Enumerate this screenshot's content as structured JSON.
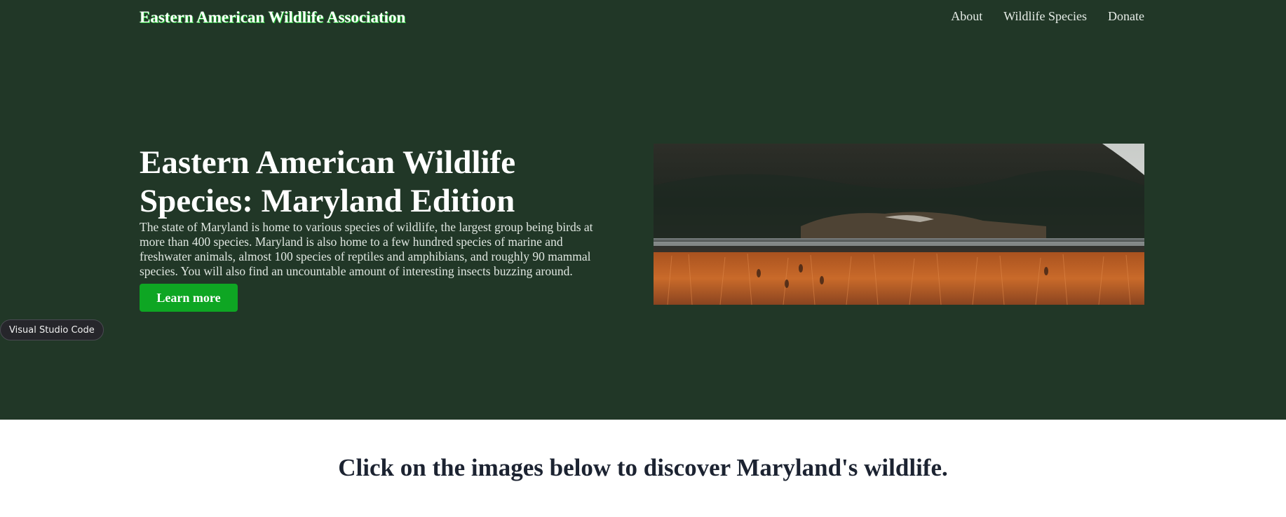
{
  "header": {
    "brand": "Eastern American Wildlife Association",
    "nav": [
      "About",
      "Wildlife Species",
      "Donate"
    ]
  },
  "hero": {
    "title": "Eastern American Wildlife Species: Maryland Edition",
    "description": "The state of Maryland is home to various species of wildlife, the largest group being birds at more than 400 species. Maryland is also home to a few hundred species of marine and freshwater animals, almost 100 species of reptiles and amphibians, and roughly 90 mammal species. You will also find an uncountable amount of interesting insects buzzing around.",
    "button_label": "Learn more",
    "image_subject": "lake-landscape-with-hills-and-reeds"
  },
  "tooltip": {
    "label": "Visual Studio Code"
  },
  "section": {
    "heading": "Click on the images below to discover Maryland's wildlife."
  },
  "colors": {
    "hero_background": "#213727",
    "button": "#0ea623",
    "heading_text": "#1c2331",
    "page_background": "#ffffff"
  }
}
